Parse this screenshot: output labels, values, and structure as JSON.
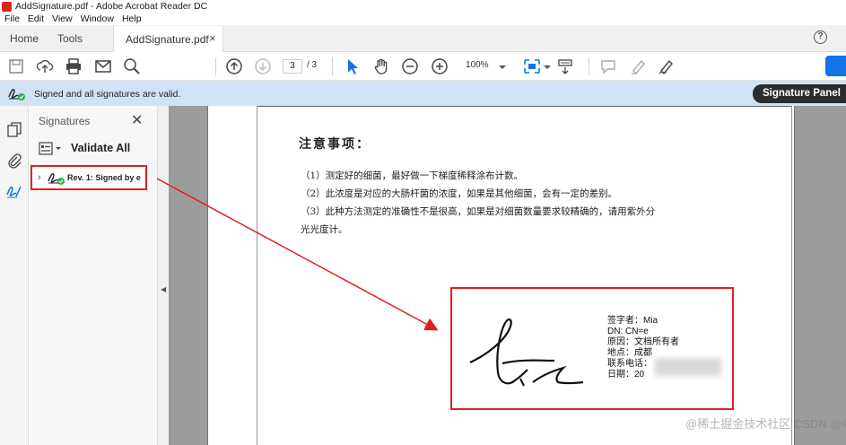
{
  "window": {
    "title": "AddSignature.pdf - Adobe Acrobat Reader DC"
  },
  "menu": [
    "File",
    "Edit",
    "View",
    "Window",
    "Help"
  ],
  "tabs": {
    "home": "Home",
    "tools": "Tools",
    "document": "AddSignature.pdf",
    "close": "×"
  },
  "help": "?",
  "toolbar": {
    "page_current": "3",
    "page_total": "/ 3",
    "zoom": "100%"
  },
  "signature_bar": {
    "status": "Signed and all signatures are valid.",
    "panel_button": "Signature Panel"
  },
  "signatures_panel": {
    "title": "Signatures",
    "close": "✕",
    "validate_all": "Validate All",
    "entry": {
      "chevron": "›",
      "label": "Rev. 1: Signed by e"
    }
  },
  "document": {
    "heading": "注意事项：",
    "lines": [
      "（1）测定好的细菌，最好做一下梯度稀释涂布计数。",
      "（2）此浓度是对应的大肠杆菌的浓度，如果是其他细菌，会有一定的差别。",
      "（3）此种方法测定的准确性不是很高，如果是对细菌数量要求较精确的，请用紫外分",
      "光光度计。"
    ],
    "signature_info": [
      "签字者：Mia",
      "DN: CN=e",
      "原因：文档所有者",
      "地点：成都",
      "联系电话：",
      "日期：20"
    ]
  },
  "watermark": "@稀土掘金技术社区 CSDN @老七949",
  "colors": {
    "accent_blue": "#1473e6",
    "annotation_red": "#e02020",
    "sig_bar": "#cfe3f5",
    "valid_green": "#2eb34a"
  }
}
